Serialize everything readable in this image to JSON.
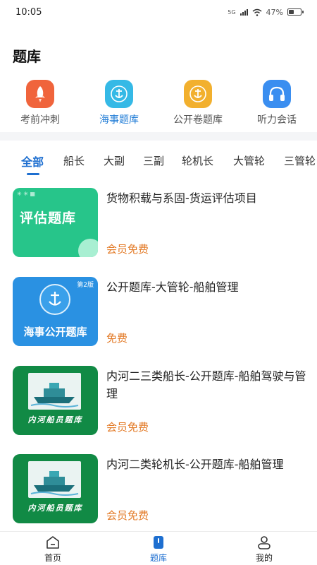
{
  "status_bar": {
    "time": "10:05",
    "network": "5G",
    "battery": "47%",
    "battery_level": 0.47
  },
  "page_title": "题库",
  "categories": [
    {
      "label": "考前冲刺",
      "icon": "rocket-icon",
      "color": "#f0643c",
      "active": false
    },
    {
      "label": "海事题库",
      "icon": "maritime-emblem-icon",
      "color": "#35b9e6",
      "active": true
    },
    {
      "label": "公开卷题库",
      "icon": "maritime-emblem-icon",
      "color": "#f2b02e",
      "active": false
    },
    {
      "label": "听力会话",
      "icon": "headphones-icon",
      "color": "#3a8ef0",
      "active": false
    }
  ],
  "tabs": [
    "全部",
    "船长",
    "大副",
    "三副",
    "轮机长",
    "大管轮",
    "三管轮"
  ],
  "active_tab": 0,
  "items": [
    {
      "title": "货物积载与系固-货运评估项目",
      "price": "会员免费",
      "thumb_text": "评估题库",
      "thumb_style": "green"
    },
    {
      "title": "公开题库-大管轮-船舶管理",
      "price": "免费",
      "thumb_text": "海事公开题库",
      "thumb_badge": "第2版",
      "thumb_style": "blue"
    },
    {
      "title": "内河二三类船长-公开题库-船舶驾驶与管理",
      "price": "会员免费",
      "thumb_text": "内河船员题库",
      "thumb_style": "dkgreen"
    },
    {
      "title": "内河二类轮机长-公开题库-船舶管理",
      "price": "会员免费",
      "thumb_text": "内河船员题库",
      "thumb_style": "dkgreen"
    }
  ],
  "bottom_nav": [
    {
      "label": "首页",
      "icon": "home-icon",
      "active": false
    },
    {
      "label": "题库",
      "icon": "question-bank-icon",
      "active": true
    },
    {
      "label": "我的",
      "icon": "profile-icon",
      "active": false
    }
  ],
  "colors": {
    "accent": "#1e6fd0",
    "price": "#e37b28"
  }
}
